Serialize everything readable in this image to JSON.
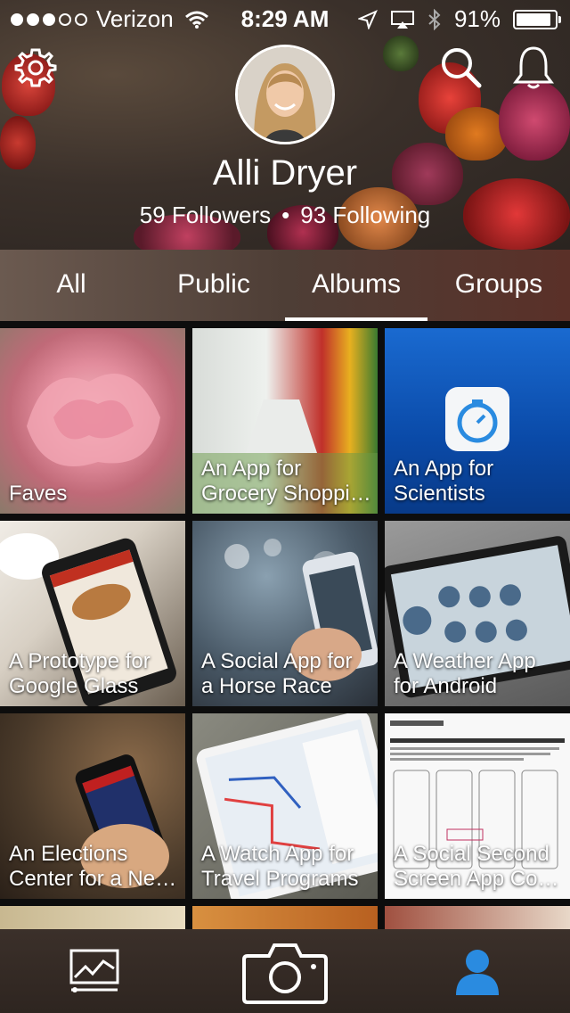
{
  "status_bar": {
    "carrier": "Verizon",
    "time": "8:29 AM",
    "battery": "91%",
    "battery_level": 0.91,
    "signal_dots_filled": 3,
    "signal_dots_total": 5
  },
  "header": {
    "settings_icon": "gear-icon",
    "search_icon": "search-icon",
    "notifications_icon": "bell-icon",
    "profile_name": "Alli Dryer",
    "followers": "59 Followers",
    "separator": "•",
    "following": "93 Following"
  },
  "tabs": [
    {
      "label": "All",
      "active": false
    },
    {
      "label": "Public",
      "active": false
    },
    {
      "label": "Albums",
      "active": true
    },
    {
      "label": "Groups",
      "active": false
    }
  ],
  "albums": [
    {
      "title": "Faves"
    },
    {
      "title": "An App for\nGrocery Shoppi…"
    },
    {
      "title": "An App for\nScientists"
    },
    {
      "title": "A Prototype for\nGoogle Glass"
    },
    {
      "title": "A Social App for\na Horse Race"
    },
    {
      "title": "A Weather App\nfor Android"
    },
    {
      "title": "An Elections\nCenter for a Ne…"
    },
    {
      "title": "A Watch App for\nTravel Programs"
    },
    {
      "title": "A Social Second\nScreen App Co…"
    }
  ],
  "bottom_nav": {
    "items": [
      "chart-icon",
      "camera-icon",
      "person-icon"
    ],
    "active": "person-icon",
    "accent": "#2a8be0"
  }
}
